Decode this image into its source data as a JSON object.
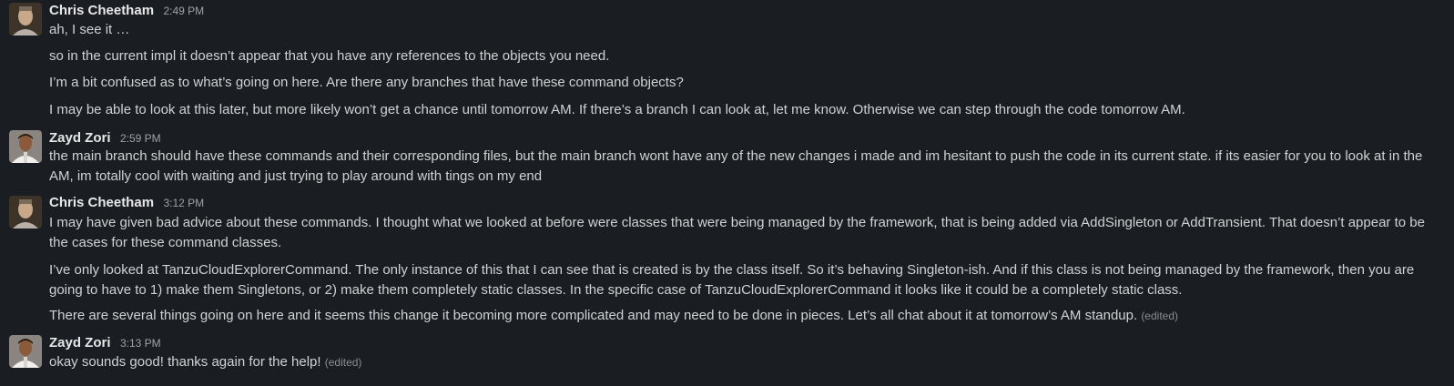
{
  "colors": {
    "background": "#1a1d21",
    "text": "#d1d2d3",
    "sender": "#e8e8e8",
    "muted": "#a0a2a6"
  },
  "messages": [
    {
      "sender": "Chris Cheetham",
      "time": "2:49 PM",
      "avatar_icon": "user-avatar-chris",
      "lines": [
        {
          "text": "ah, I see it …"
        },
        {
          "text": "so in the current impl it doesn’t appear that you have any references to the objects you need."
        },
        {
          "text": "I’m a bit confused as to what’s going on here.  Are there any branches that have these command objects?"
        },
        {
          "text": "I may be able to look at this later, but more likely won’t get a chance until tomorrow AM.  If there’s a branch I can look at, let me know.  Otherwise we can step through the code tomorrow AM."
        }
      ]
    },
    {
      "sender": "Zayd Zori",
      "time": "2:59 PM",
      "avatar_icon": "user-avatar-zayd",
      "lines": [
        {
          "text": "the main branch should have these commands and their corresponding files, but the main branch wont have any of the new changes i made and im hesitant to push the code in its current state. if its easier for you to look at in the AM, im totally cool with waiting and just trying to play around with tings on my end"
        }
      ]
    },
    {
      "sender": "Chris Cheetham",
      "time": "3:12 PM",
      "avatar_icon": "user-avatar-chris",
      "lines": [
        {
          "text": "I may have given bad advice about these commands.  I thought what we looked at before were classes that were being managed by the framework, that is being added via AddSingleton or AddTransient.  That doesn’t appear to be the cases for these command classes."
        },
        {
          "text": "I’ve only looked at TanzuCloudExplorerCommand.  The only instance of this that I can see that is created is by the class itself.  So it’s behaving Singleton-ish.  And if this class is not being managed by the framework, then you are going to have to 1) make them Singletons, or 2) make them completely static classes.  In the specific case of TanzuCloudExplorerCommand it looks like it could be a completely static class."
        },
        {
          "text": "There are several things going on here and it seems this change it becoming more complicated and may need to be done in pieces.  Let’s all chat about it at tomorrow’s AM standup.",
          "edited": "(edited)"
        }
      ]
    },
    {
      "sender": "Zayd Zori",
      "time": "3:13 PM",
      "avatar_icon": "user-avatar-zayd",
      "lines": [
        {
          "text": "okay sounds good! thanks again for the help!",
          "edited": "(edited)"
        }
      ]
    }
  ]
}
